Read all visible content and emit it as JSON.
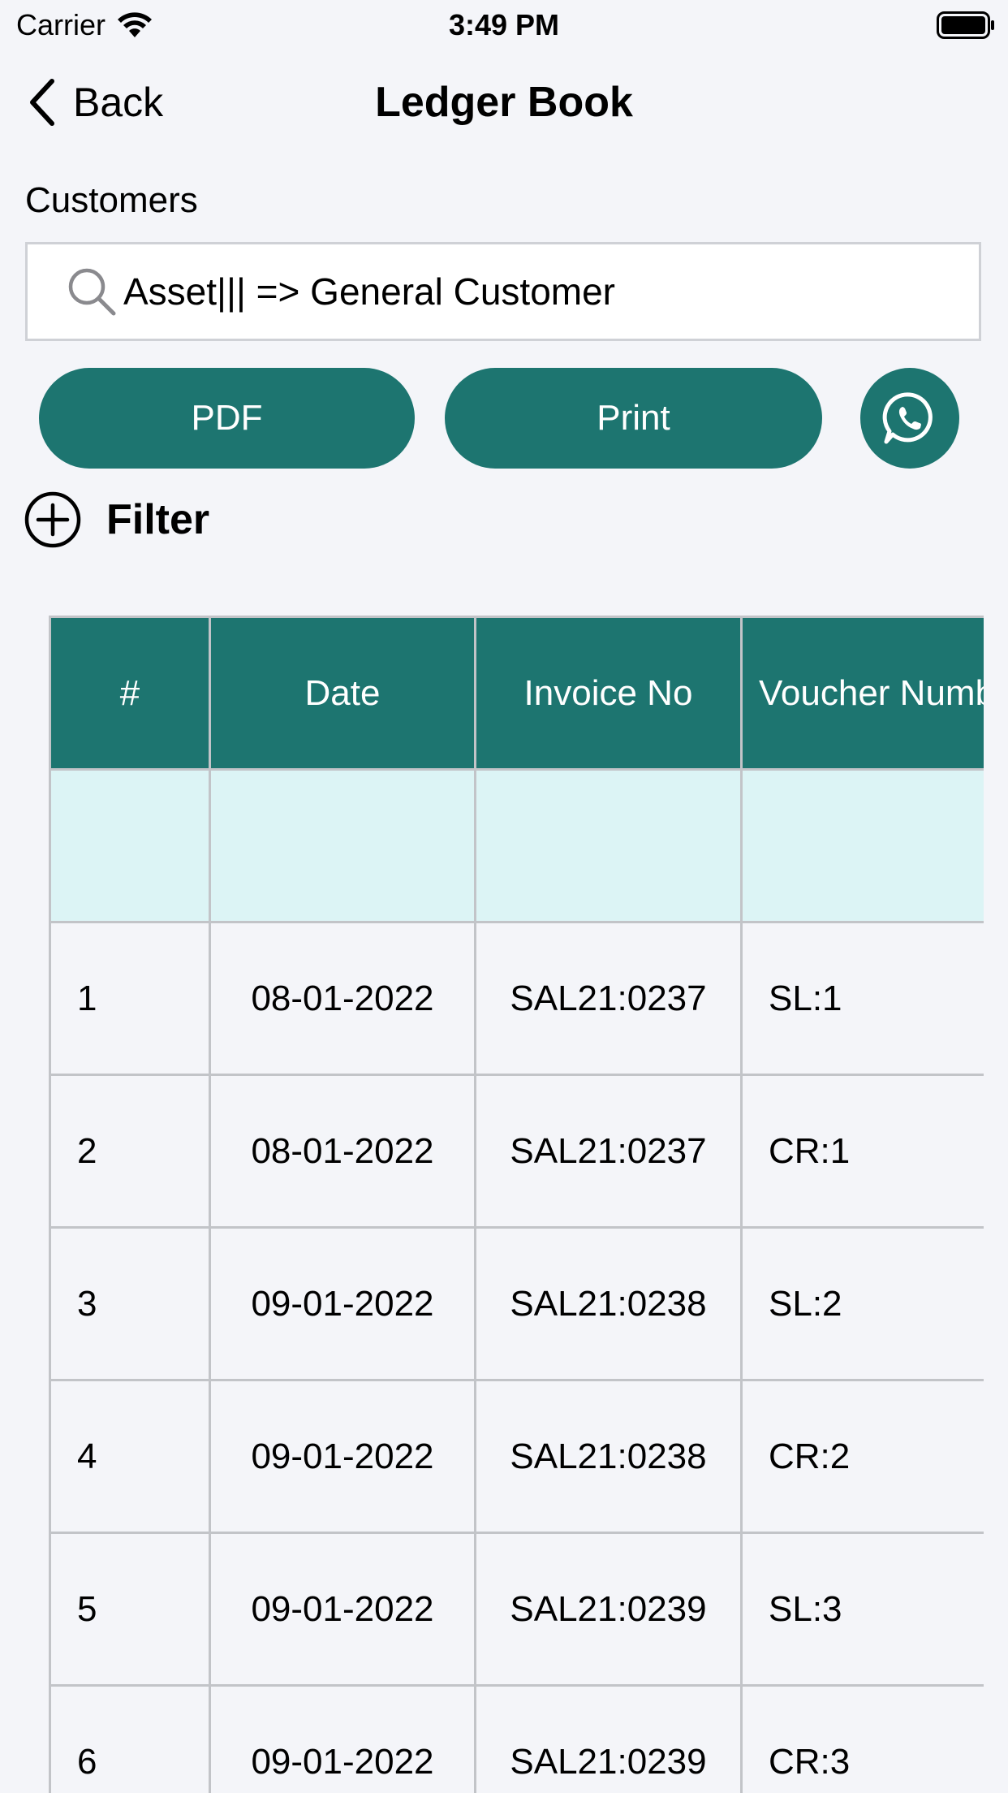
{
  "status_bar": {
    "carrier": "Carrier",
    "time": "3:49 PM"
  },
  "nav": {
    "back_label": "Back",
    "title": "Ledger Book"
  },
  "customers": {
    "label": "Customers",
    "search_value": "Asset||| => General Customer"
  },
  "actions": {
    "pdf_label": "PDF",
    "print_label": "Print",
    "whatsapp_icon": "whatsapp-icon"
  },
  "filter": {
    "label": "Filter"
  },
  "colors": {
    "accent": "#1d7570",
    "summary_row": "#dcf4f5",
    "background": "#f4f5f9"
  },
  "table": {
    "headers": [
      "#",
      "Date",
      "Invoice No",
      "Voucher Number"
    ],
    "rows": [
      {
        "num": "1",
        "date": "08-01-2022",
        "invoice": "SAL21:0237",
        "voucher": "SL:1"
      },
      {
        "num": "2",
        "date": "08-01-2022",
        "invoice": "SAL21:0237",
        "voucher": "CR:1"
      },
      {
        "num": "3",
        "date": "09-01-2022",
        "invoice": "SAL21:0238",
        "voucher": "SL:2"
      },
      {
        "num": "4",
        "date": "09-01-2022",
        "invoice": "SAL21:0238",
        "voucher": "CR:2"
      },
      {
        "num": "5",
        "date": "09-01-2022",
        "invoice": "SAL21:0239",
        "voucher": "SL:3"
      },
      {
        "num": "6",
        "date": "09-01-2022",
        "invoice": "SAL21:0239",
        "voucher": "CR:3"
      }
    ]
  }
}
